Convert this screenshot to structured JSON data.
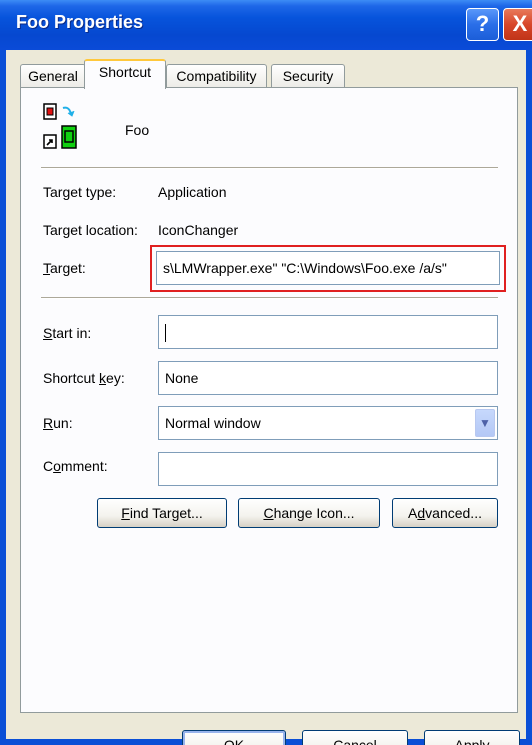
{
  "window": {
    "title": "Foo Properties",
    "help_glyph": "?",
    "close_glyph": "X"
  },
  "tabs": [
    {
      "label": "General"
    },
    {
      "label": "Shortcut"
    },
    {
      "label": "Compatibility"
    },
    {
      "label": "Security"
    }
  ],
  "shortcut": {
    "name": "Foo",
    "target_type_label": "Target type:",
    "target_type_value": "Application",
    "target_location_label": "Target location:",
    "target_location_value": "IconChanger",
    "target_label_u": "T",
    "target_label_rest": "arget:",
    "target_value": "s\\LMWrapper.exe\" \"C:\\Windows\\Foo.exe /a/s\"",
    "start_in_label_u": "S",
    "start_in_label_rest": "tart in:",
    "start_in_value": "",
    "shortcut_key_label_pre": "Shortcut ",
    "shortcut_key_label_u": "k",
    "shortcut_key_label_rest": "ey:",
    "shortcut_key_value": "None",
    "run_label_u": "R",
    "run_label_rest": "un:",
    "run_value": "Normal window",
    "comment_label_pre": "C",
    "comment_label_u": "o",
    "comment_label_rest": "mment:",
    "comment_value": ""
  },
  "action_buttons": {
    "find_target_u": "F",
    "find_target_rest": "ind Target...",
    "change_icon_u": "C",
    "change_icon_rest": "hange Icon...",
    "advanced_pre": "A",
    "advanced_u": "d",
    "advanced_rest": "vanced..."
  },
  "footer_buttons": {
    "ok": "OK",
    "cancel": "Cancel",
    "apply_u": "A",
    "apply_rest": "pply"
  },
  "colors": {
    "highlight": "#e02020",
    "titlebar": "#0754dc",
    "panel": "#fcfcfe",
    "dialog": "#ece9d8"
  }
}
